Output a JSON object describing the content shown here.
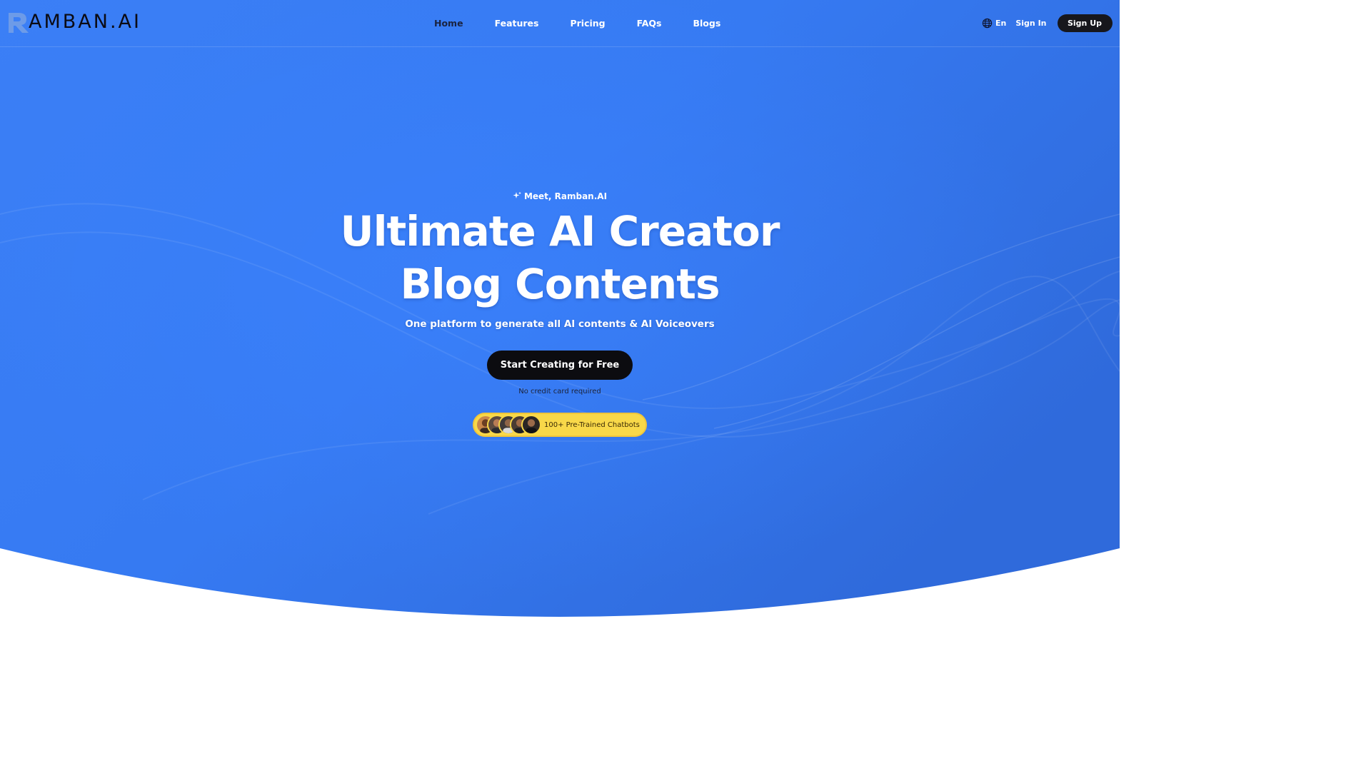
{
  "brand": {
    "logo_text": "AMBAN.AI"
  },
  "nav": {
    "items": [
      {
        "label": "Home",
        "active": true
      },
      {
        "label": "Features",
        "active": false
      },
      {
        "label": "Pricing",
        "active": false
      },
      {
        "label": "FAQs",
        "active": false
      },
      {
        "label": "Blogs",
        "active": false
      }
    ]
  },
  "header_right": {
    "language": "En",
    "sign_in": "Sign In",
    "sign_up": "Sign Up"
  },
  "hero": {
    "eyebrow": "Meet, Ramban.AI",
    "title_line1": "Ultimate AI Creator",
    "title_line2": "Blog Contents",
    "subtitle": "One platform to generate all AI contents & AI Voiceovers",
    "cta_label": "Start Creating for Free",
    "cta_note": "No credit card required",
    "badge_text": "100+ Pre-Trained Chatbots"
  },
  "icons": {
    "logo": "ramban-logo-mark",
    "language": "globe-icon",
    "eyebrow": "sparkle-icon"
  },
  "colors": {
    "hero_blue": "#3478f0",
    "button_dark": "#0c0c10",
    "badge_yellow": "#f8d849",
    "nav_active": "#1a2340"
  }
}
